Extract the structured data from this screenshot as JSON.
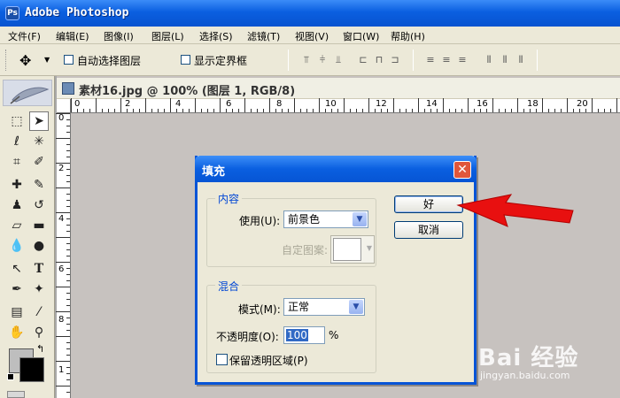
{
  "app": {
    "title": "Adobe Photoshop",
    "icon_label": "Ps"
  },
  "menu": [
    "文件(F)",
    "编辑(E)",
    "图像(I)",
    "图层(L)",
    "选择(S)",
    "滤镜(T)",
    "视图(V)",
    "窗口(W)",
    "帮助(H)"
  ],
  "options": {
    "move_tool_icon": "move-tool-icon",
    "auto_select_label": "自动选择图层",
    "show_bounds_label": "显示定界框"
  },
  "document": {
    "title": "素材16.jpg @ 100% (图层 1, RGB/8)",
    "ruler_top": [
      "0",
      "2",
      "4",
      "6",
      "8",
      "10",
      "12",
      "14",
      "16",
      "18",
      "20"
    ],
    "ruler_left": [
      "0",
      "2",
      "4",
      "6",
      "8",
      "1"
    ]
  },
  "dialog": {
    "title": "填充",
    "close_glyph": "✕",
    "content_group": "内容",
    "use_label": "使用(U):",
    "use_value": "前景色",
    "pattern_label": "自定图案:",
    "blend_group": "混合",
    "mode_label": "模式(M):",
    "mode_value": "正常",
    "opacity_label": "不透明度(O):",
    "opacity_value": "100",
    "opacity_unit": "%",
    "preserve_label": "保留透明区域(P)",
    "ok_label": "好",
    "cancel_label": "取消"
  },
  "watermark": {
    "brand": "Bai 经验",
    "url": "jingyan.baidu.com"
  },
  "colors": {
    "titlebar": "#0a5fe0",
    "dialog_border": "#0754d6",
    "arrow": "#e81010",
    "canvas": "#c7c2bf"
  }
}
